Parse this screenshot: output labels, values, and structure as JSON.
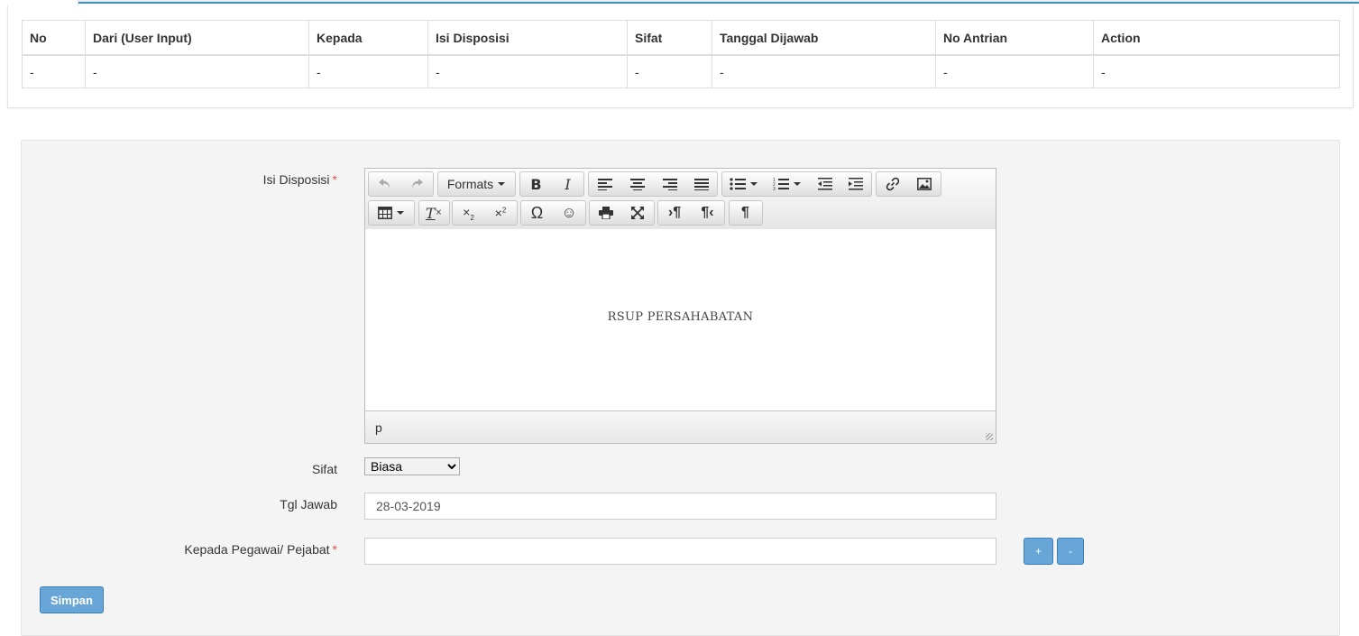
{
  "table": {
    "headers": [
      "No",
      "Dari (User Input)",
      "Kepada",
      "Isi Disposisi",
      "Sifat",
      "Tanggal Dijawab",
      "No Antrian",
      "Action"
    ],
    "rows": [
      [
        "-",
        "-",
        "-",
        "-",
        "-",
        "-",
        "-",
        "-"
      ]
    ]
  },
  "form": {
    "isi_label": "Isi Disposisi",
    "sifat_label": "Sifat",
    "tgl_label": "Tgl Jawab",
    "kepada_label": "Kepada Pegawai/ Pejabat",
    "required_mark": "*",
    "sifat_selected": "Biasa",
    "tgl_value": "28-03-2019",
    "kepada_value": "",
    "add_label": "+",
    "remove_label": "-",
    "submit_label": "Simpan"
  },
  "editor": {
    "formats_label": "Formats",
    "content_text": "RSUP PERSAHABATAN",
    "path_text": "p"
  },
  "colors": {
    "accent": "#3c8dbc",
    "button": "#68a6d7",
    "required": "#d9534f"
  }
}
